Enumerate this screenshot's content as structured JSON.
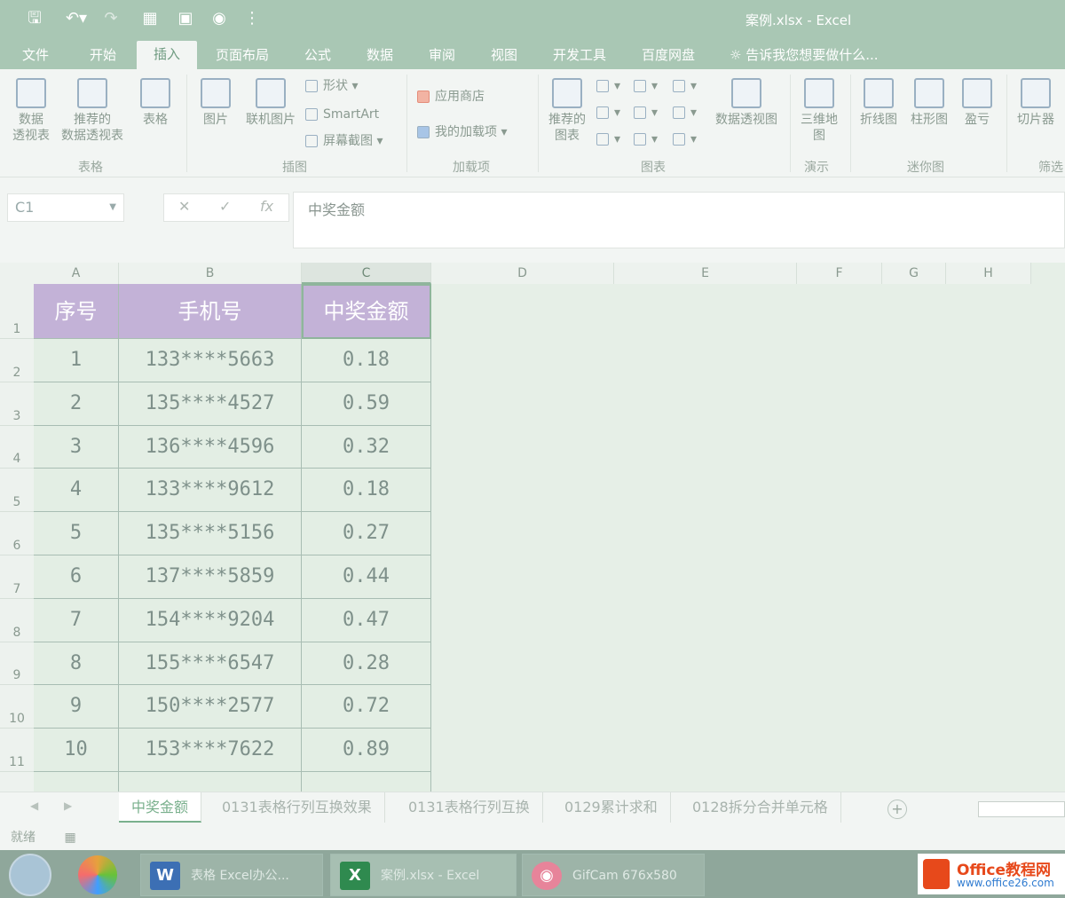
{
  "window": {
    "title": "案例.xlsx - Excel"
  },
  "tabs": [
    "文件",
    "开始",
    "插入",
    "页面布局",
    "公式",
    "数据",
    "审阅",
    "视图",
    "开发工具",
    "百度网盘"
  ],
  "active_tab": "插入",
  "tell_me": "告诉我您想要做什么...",
  "ribbon": {
    "groups": {
      "tables": {
        "label": "表格",
        "items": [
          "数据\n透视表",
          "推荐的\n数据透视表",
          "表格"
        ]
      },
      "illustrations": {
        "label": "插图",
        "big": [
          "图片",
          "联机图片"
        ],
        "small": [
          "形状",
          "SmartArt",
          "屏幕截图"
        ]
      },
      "addins": {
        "label": "加载项",
        "items": [
          "应用商店",
          "我的加载项"
        ]
      },
      "charts": {
        "label": "图表",
        "big": [
          "推荐的\n图表",
          "数据透视图"
        ]
      },
      "tours": {
        "label": "演示",
        "items": [
          "三维地\n图"
        ]
      },
      "sparklines": {
        "label": "迷你图",
        "items": [
          "折线图",
          "柱形图",
          "盈亏"
        ]
      },
      "filters": {
        "label": "筛选",
        "items": [
          "切片器"
        ]
      }
    }
  },
  "formula_bar": {
    "name_box": "C1",
    "formula": "中奖金额"
  },
  "sheet": {
    "columns": [
      "A",
      "B",
      "C",
      "D",
      "E",
      "F",
      "G",
      "H"
    ],
    "rows": [
      "1",
      "2",
      "3",
      "4",
      "5",
      "6",
      "7",
      "8",
      "9",
      "10",
      "11"
    ],
    "header": [
      "序号",
      "手机号",
      "中奖金额"
    ],
    "data": [
      [
        "1",
        "133****5663",
        "0.18"
      ],
      [
        "2",
        "135****4527",
        "0.59"
      ],
      [
        "3",
        "136****4596",
        "0.32"
      ],
      [
        "4",
        "133****9612",
        "0.18"
      ],
      [
        "5",
        "135****5156",
        "0.27"
      ],
      [
        "6",
        "137****5859",
        "0.44"
      ],
      [
        "7",
        "154****9204",
        "0.47"
      ],
      [
        "8",
        "155****6547",
        "0.28"
      ],
      [
        "9",
        "150****2577",
        "0.72"
      ],
      [
        "10",
        "153****7622",
        "0.89"
      ]
    ]
  },
  "sheet_tabs": [
    "中奖金额",
    "0131表格行列互换效果",
    "0131表格行列互换",
    "0129累计求和",
    "0128拆分合并单元格"
  ],
  "status": "就绪",
  "taskbar": {
    "items": [
      "表格 Excel办公...",
      "案例.xlsx - Excel",
      "GifCam 676x580"
    ]
  },
  "watermark": {
    "brand": "Office教程网",
    "url": "www.office26.com"
  },
  "colors": {
    "accent": "#a9c7b4",
    "header_fill": "#c3b2d7",
    "cell_fill": "#e3eee4"
  }
}
